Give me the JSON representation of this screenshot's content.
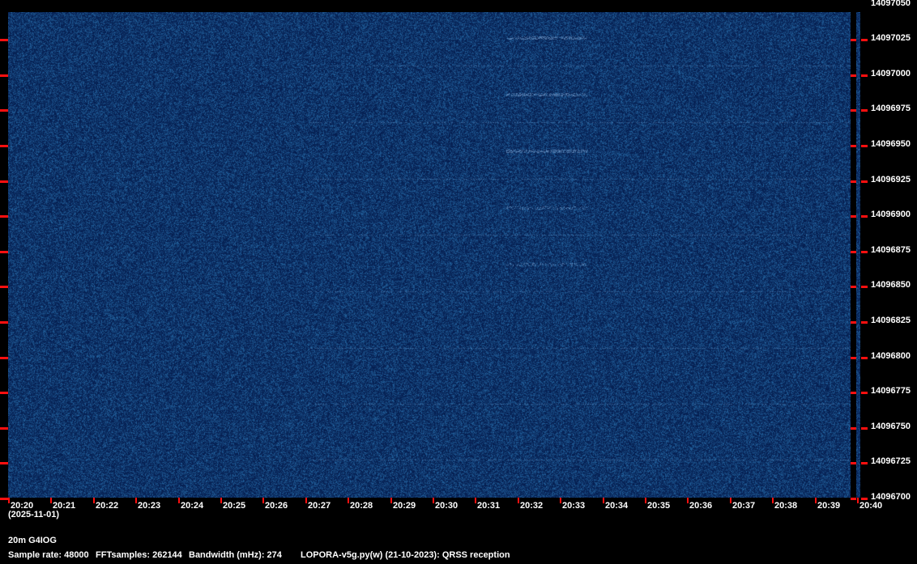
{
  "plot": {
    "time_labels": [
      "20:20",
      "20:21",
      "20:22",
      "20:23",
      "20:24",
      "20:25",
      "20:26",
      "20:27",
      "20:28",
      "20:29",
      "20:30",
      "20:31",
      "20:32",
      "20:33",
      "20:34",
      "20:35",
      "20:36",
      "20:37",
      "20:38",
      "20:39",
      "20:40"
    ],
    "date": "(2025-11-01)",
    "freq_labels": [
      "14097050",
      "14097025",
      "14097000",
      "14096975",
      "14096950",
      "14096925",
      "14096900",
      "14096875",
      "14096850",
      "14096825",
      "14096800",
      "14096775",
      "14096750",
      "14096725",
      "14096700"
    ],
    "colors": {
      "background": "#0a2a5e",
      "tick": "#ff1010",
      "text": "#ffffff"
    }
  },
  "footer": {
    "station": "20m G4IOG",
    "sample_rate": "Sample rate: 48000",
    "fft_samples": "FFTsamples: 262144",
    "bandwidth": "Bandwidth (mHz): 274",
    "software": "LOPORA-v5g.py(w) (21-10-2023): QRSS reception"
  }
}
